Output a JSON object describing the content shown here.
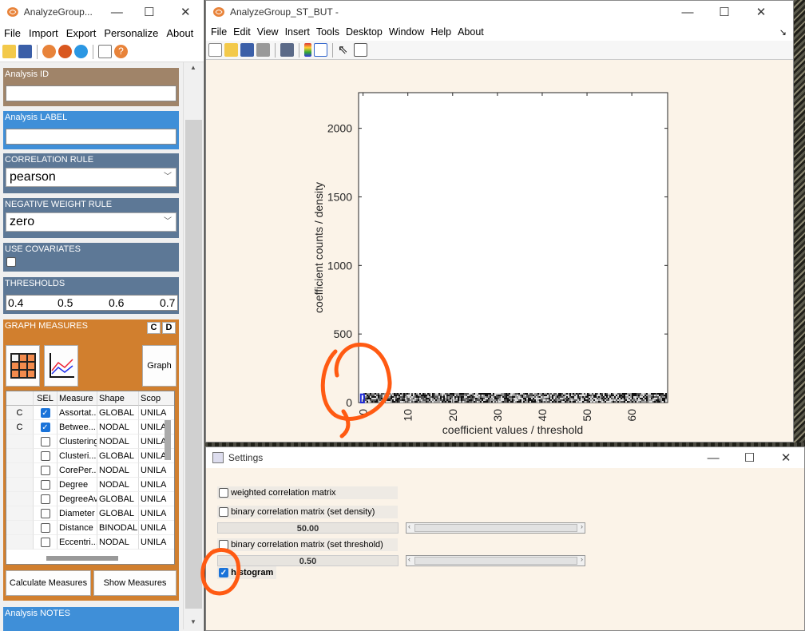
{
  "left_window": {
    "title": "AnalyzeGroup...",
    "menu": [
      "File",
      "Import",
      "Export",
      "Personalize",
      "About"
    ],
    "toolbar_icons": [
      "open-folder-icon",
      "save-icon",
      "globe-icon",
      "orange-circle-icon",
      "twitter-icon",
      "notes-icon",
      "help-icon"
    ],
    "analysis_id": {
      "label": "Analysis ID",
      "value": ""
    },
    "analysis_label": {
      "label": "Analysis LABEL",
      "value": ""
    },
    "correlation_rule": {
      "label": "CORRELATION RULE",
      "value": "pearson"
    },
    "negative_weight_rule": {
      "label": "NEGATIVE WEIGHT RULE",
      "value": "zero"
    },
    "use_covariates": {
      "label": "USE COVARIATES",
      "checked": false
    },
    "thresholds": {
      "label": "THRESHOLDS",
      "values": [
        "0.4",
        "0.5",
        "0.6",
        "0.7"
      ]
    },
    "graph_measures": {
      "label": "GRAPH MEASURES",
      "btn_c": "C",
      "btn_d": "D",
      "graph_button": "Graph ...",
      "columns": [
        "",
        "SEL",
        "Measure",
        "Shape",
        "Scop"
      ],
      "rows": [
        {
          "c": "C",
          "sel": true,
          "measure": "Assortat...",
          "shape": "GLOBAL",
          "scope": "UNILA"
        },
        {
          "c": "C",
          "sel": true,
          "measure": "Betwee...",
          "shape": "NODAL",
          "scope": "UNILA"
        },
        {
          "c": "",
          "sel": false,
          "measure": "Clustering",
          "shape": "NODAL",
          "scope": "UNILA"
        },
        {
          "c": "",
          "sel": false,
          "measure": "Clusteri...",
          "shape": "GLOBAL",
          "scope": "UNILA"
        },
        {
          "c": "",
          "sel": false,
          "measure": "CorePer...",
          "shape": "NODAL",
          "scope": "UNILA"
        },
        {
          "c": "",
          "sel": false,
          "measure": "Degree",
          "shape": "NODAL",
          "scope": "UNILA"
        },
        {
          "c": "",
          "sel": false,
          "measure": "DegreeAv",
          "shape": "GLOBAL",
          "scope": "UNILA"
        },
        {
          "c": "",
          "sel": false,
          "measure": "Diameter",
          "shape": "GLOBAL",
          "scope": "UNILA"
        },
        {
          "c": "",
          "sel": false,
          "measure": "Distance",
          "shape": "BINODAL",
          "scope": "UNILA"
        },
        {
          "c": "",
          "sel": false,
          "measure": "Eccentri...",
          "shape": "NODAL",
          "scope": "UNILA"
        }
      ]
    },
    "calculate_button": "Calculate Measures",
    "show_button": "Show Measures",
    "analysis_notes": {
      "label": "Analysis NOTES"
    },
    "colors": {
      "id_panel": "#a08469",
      "label_panel": "#3f8fd8",
      "rule_panel": "#5d7896",
      "measures_panel": "#d17f2e"
    }
  },
  "figure_window": {
    "title": "AnalyzeGroup_ST_BUT -",
    "menu": [
      "File",
      "Edit",
      "View",
      "Insert",
      "Tools",
      "Desktop",
      "Window",
      "Help",
      "About"
    ],
    "toolbar_icons": [
      "new-file-icon",
      "open-folder-icon",
      "save-icon",
      "print-icon",
      "link-icon",
      "colorbar-icon",
      "legend-icon",
      "pointer-icon",
      "property-inspector-icon"
    ],
    "chart_data": {
      "type": "bar",
      "xlabel": "coefficient values / threshold",
      "ylabel": "coefficient counts / density",
      "xlim": [
        -1,
        68
      ],
      "ylim": [
        0,
        2260
      ],
      "xticks": [
        0,
        10,
        20,
        30,
        40,
        50,
        60
      ],
      "yticks": [
        0,
        500,
        1000,
        1500,
        2000
      ],
      "grid": false
    }
  },
  "settings_window": {
    "title": "Settings",
    "weighted": {
      "label": "weighted correlation matrix",
      "checked": false
    },
    "binary_density": {
      "label": "binary correlation matrix (set density)",
      "checked": false,
      "value": "50.00",
      "slider": 0.5
    },
    "binary_threshold": {
      "label": "binary correlation matrix (set threshold)",
      "checked": false,
      "value": "0.50",
      "slider": 0.5
    },
    "histogram": {
      "label": "histogram",
      "checked": true
    }
  }
}
